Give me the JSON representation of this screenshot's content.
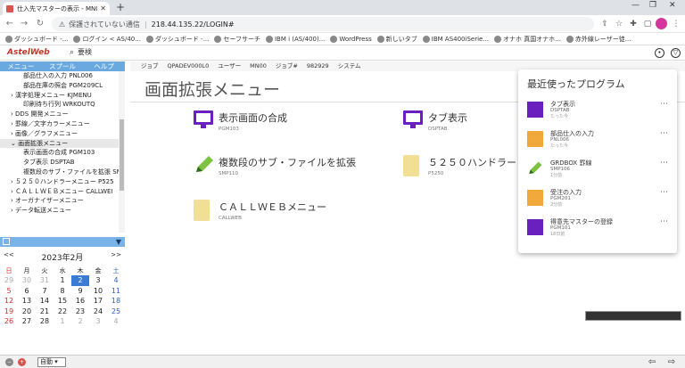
{
  "browser": {
    "tab_title": "仕入先マスターの表示 - MN00",
    "omni_insecure": "保護されていない通信",
    "omni_url": "218.44.135.22/LOGIN#",
    "bookmarks": [
      "ダッシュボード -...",
      "ログイン < AS/40...",
      "ダッシュボード -...",
      "セーフサーチ",
      "IBM i (AS/400)...",
      "WordPress",
      "新しいタブ",
      "IBM AS400iSerie...",
      "オナホ 真国オナホ...",
      "赤外線レーザー徒..."
    ]
  },
  "app": {
    "logo": "AstelWeb",
    "search_placeholder": "要検",
    "menutabs": [
      "メニュー",
      "スプール",
      "ヘルプ"
    ],
    "tree": [
      "部品仕入の入力 PNL006",
      "部品在庫の照会 PGM209CL",
      "› 漢字処理メニュー KJMENU",
      "印刷待ち行列 WRKOUTQ",
      "› DDS 開発メニュー",
      "› 罫線／文字カラーメニュー",
      "› 画像／グラフメニュー",
      "⌄ 画面拡張メニュー",
      "表示画面の合成 PGM103",
      "タブ表示 DSPTAB",
      "複数段のサブ・ファイルを拡張 SM",
      "› ５２５０ハンドラーメニュー P525",
      "› ＣＡＬＬＷＥＢメニュー CALLWEI",
      "› オーガナイザーメニュー",
      "› データ転送メニュー"
    ],
    "tree_selected_index": 7,
    "calendar": {
      "prev": "<<",
      "next": ">>",
      "title": "2023年2月",
      "dow": [
        "日",
        "月",
        "火",
        "水",
        "木",
        "金",
        "土"
      ],
      "weeks": [
        [
          "29",
          "30",
          "31",
          "1",
          "2",
          "3",
          "4"
        ],
        [
          "5",
          "6",
          "7",
          "8",
          "9",
          "10",
          "11"
        ],
        [
          "12",
          "13",
          "14",
          "15",
          "16",
          "17",
          "18"
        ],
        [
          "19",
          "20",
          "21",
          "22",
          "23",
          "24",
          "25"
        ],
        [
          "26",
          "27",
          "28",
          "1",
          "2",
          "3",
          "4"
        ]
      ],
      "today": "2"
    },
    "jobbar": [
      "ジョブ",
      "QPADEV000L0",
      "ユーザー",
      "MN00",
      "ジョブ#",
      "982929",
      "システム"
    ],
    "page_title": "画面拡張メニュー",
    "items": [
      {
        "label": "表示画面の合成",
        "code": "PGM103",
        "icon": "monitor-icon"
      },
      {
        "label": "タブ表示",
        "code": "DSPTAB",
        "icon": "monitor-icon"
      },
      {
        "label": "複数段のサブ・ファイルを拡張",
        "code": "SMP110",
        "icon": "pencil-icon"
      },
      {
        "label": "５２５０ハンドラー",
        "code": "P5250",
        "icon": "folder-icon"
      },
      {
        "label": "ＣＡＬＬＷＥＢメニュー",
        "code": "CALLWEB",
        "icon": "folder-icon"
      }
    ],
    "recent": {
      "title": "最近使ったプログラム",
      "items": [
        {
          "name": "タブ表示",
          "code": "DSPTAB",
          "time": "たった今",
          "icon": "monitor-icon"
        },
        {
          "name": "部品仕入の入力",
          "code": "PNL006",
          "time": "たった今",
          "icon": "download-icon"
        },
        {
          "name": "GRDBOX 罫線",
          "code": "SMP106",
          "time": "1分前",
          "icon": "pencil-icon"
        },
        {
          "name": "受注の入力",
          "code": "PGM201",
          "time": "2分前",
          "icon": "download-icon"
        },
        {
          "name": "得意先マスターの登録",
          "code": "PGM101",
          "time": "18日前",
          "icon": "form-icon"
        }
      ]
    },
    "status": {
      "mode": "自動"
    }
  },
  "colors": {
    "accent_purple": "#6a1fbf",
    "accent_orange": "#f2a93b",
    "tab_blue": "#6aa9e0"
  }
}
